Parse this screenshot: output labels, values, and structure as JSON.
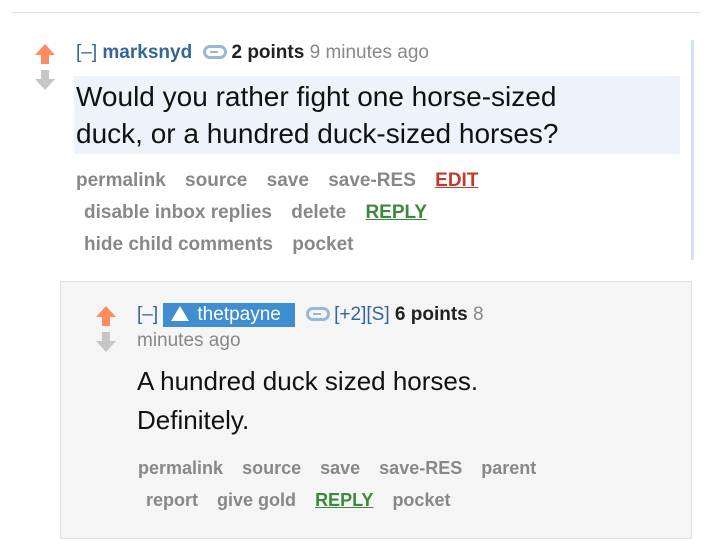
{
  "comment1": {
    "collapse": "[–]",
    "author": "marksnyd",
    "score": "2 points",
    "time": "9 minutes ago",
    "body_line1": "Would you rather fight one horse-sized",
    "body_line2": "duck, or a hundred duck-sized horses?",
    "buttons": {
      "permalink": "permalink",
      "source": "source",
      "save": "save",
      "save_res": "save-RES",
      "edit": "EDIT",
      "disable_inbox": "disable inbox replies",
      "delete": "delete",
      "reply": "REPLY",
      "hide_child": "hide child comments",
      "pocket": "pocket"
    }
  },
  "comment2": {
    "collapse": "[–]",
    "author": "thetpayne",
    "vote_info": "[+2][S]",
    "score": "6 points",
    "time_part1": "8",
    "time_part2": "minutes ago",
    "body_line1": "A hundred duck sized horses.",
    "body_line2": "Definitely.",
    "buttons": {
      "permalink": "permalink",
      "source": "source",
      "save": "save",
      "save_res": "save-RES",
      "parent": "parent",
      "report": "report",
      "give_gold": "give gold",
      "reply": "REPLY",
      "pocket": "pocket"
    }
  },
  "colors": {
    "upvote": "#ff8b60",
    "downvote": "#c6c6c6",
    "author_link": "#336699",
    "edit": "#c0392b",
    "reply": "#3b8a3b",
    "mod_badge": "#3e8ed0"
  },
  "icons": [
    "upvote-arrow-icon",
    "downvote-arrow-icon",
    "user-tag-icon",
    "moderator-icon"
  ]
}
